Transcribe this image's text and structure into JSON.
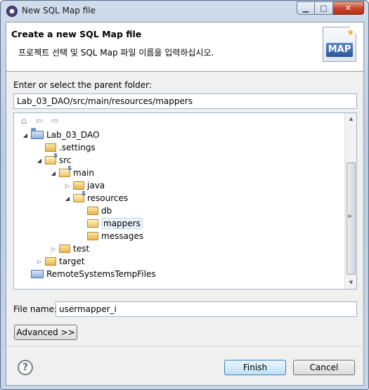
{
  "window": {
    "title": "New SQL Map file"
  },
  "banner": {
    "title": "Create a new SQL Map file",
    "description": "프로젝트 선택 및 SQL Map 파일 이름을 입력하십시오.",
    "logo_text": "MAP"
  },
  "folder": {
    "label": "Enter or select the parent folder:",
    "value": "Lab_03_DAO/src/main/resources/mappers"
  },
  "tree": {
    "items": [
      {
        "label": "Lab_03_DAO"
      },
      {
        "label": ".settings"
      },
      {
        "label": "src"
      },
      {
        "label": "main"
      },
      {
        "label": "java"
      },
      {
        "label": "resources"
      },
      {
        "label": "db"
      },
      {
        "label": "mappers"
      },
      {
        "label": "messages"
      },
      {
        "label": "test"
      },
      {
        "label": "target"
      },
      {
        "label": "RemoteSystemsTempFiles"
      }
    ]
  },
  "filename": {
    "label": "File name:",
    "value": "usermapper_i"
  },
  "buttons": {
    "advanced": "Advanced >>",
    "finish": "Finish",
    "cancel": "Cancel"
  },
  "icons": {
    "app": "eclipse-icon",
    "home": "home-icon",
    "back": "back-arrow-icon",
    "forward": "forward-arrow-icon",
    "help": "help-icon"
  }
}
